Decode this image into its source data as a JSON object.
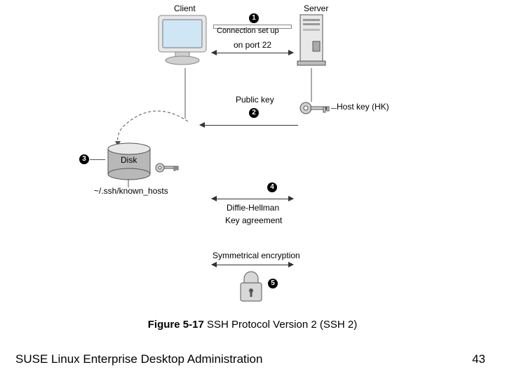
{
  "footer": {
    "left": "SUSE Linux Enterprise Desktop Administration",
    "page": "43"
  },
  "caption": {
    "prefix": "Figure 5-17",
    "text": " SSH Protocol Version 2 (SSH 2)"
  },
  "labels": {
    "client": "Client",
    "server": "Server",
    "publicKey": "Public key",
    "hostKey": "Host key (HK)",
    "disk": "Disk",
    "knownHosts": "~/.ssh/known_hosts",
    "diffie": "Diffie-Hellman",
    "keyAgree": "Key agreement",
    "symEnc": "Symmetrical encryption"
  },
  "step1": {
    "line1": "Connection set up",
    "line2": "on port 22"
  },
  "callouts": {
    "c1": "1",
    "c2": "2",
    "c3": "3",
    "c4": "4",
    "c5": "5"
  }
}
